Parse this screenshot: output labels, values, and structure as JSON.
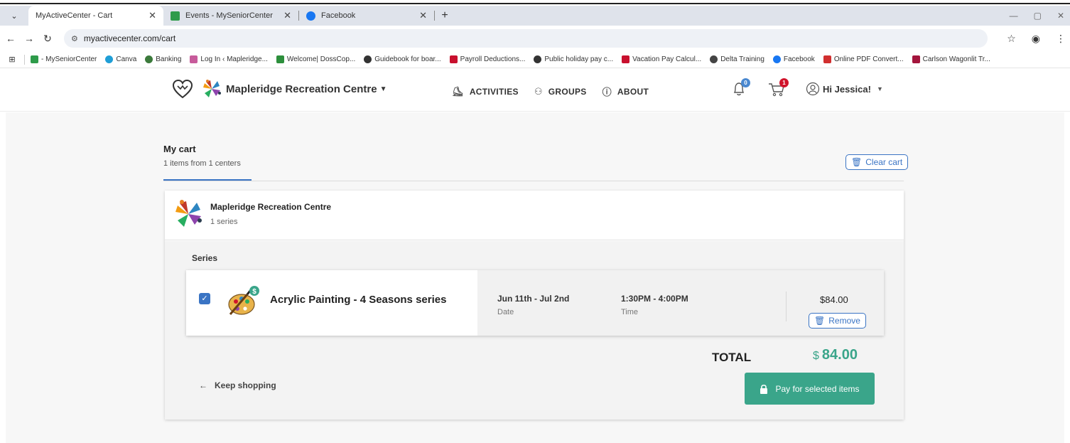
{
  "browser": {
    "tabs": [
      {
        "title": "MyActiveCenter - Cart",
        "active": true
      },
      {
        "title": "Events - MySeniorCenter",
        "active": false
      },
      {
        "title": "Facebook",
        "active": false
      }
    ],
    "url": "myactivecenter.com/cart",
    "bookmarks": [
      {
        "label": "- MySeniorCenter",
        "color": "#2e9b4a"
      },
      {
        "label": "Canva",
        "color": "#1f9ed6"
      },
      {
        "label": "Banking",
        "color": "#3b7a3b"
      },
      {
        "label": "Log In ‹ Mapleridge...",
        "color": "#c75b9b"
      },
      {
        "label": "Welcome| DossCop...",
        "color": "#2d8f3c"
      },
      {
        "label": "Guidebook for boar...",
        "color": "#333333"
      },
      {
        "label": "Payroll Deductions...",
        "color": "#c8102e"
      },
      {
        "label": "Public holiday pay c...",
        "color": "#333333"
      },
      {
        "label": "Vacation Pay Calcul...",
        "color": "#c8102e"
      },
      {
        "label": "Delta Training",
        "color": "#444444"
      },
      {
        "label": "Facebook",
        "color": "#1877f2"
      },
      {
        "label": "Online PDF Convert...",
        "color": "#d12f2f"
      },
      {
        "label": "Carlson Wagonlit Tr...",
        "color": "#a3153c"
      }
    ]
  },
  "header": {
    "center_name": "Mapleridge Recreation Centre",
    "nav": [
      {
        "label": "ACTIVITIES",
        "icon": "ice-skate-icon"
      },
      {
        "label": "GROUPS",
        "icon": "people-icon"
      },
      {
        "label": "ABOUT",
        "icon": "question-circle-icon"
      }
    ],
    "notifications_count": "0",
    "cart_count": "1",
    "greeting": "Hi Jessica!"
  },
  "cart": {
    "title": "My cart",
    "subtitle": "1 items from 1 centers",
    "clear_label": "Clear cart",
    "center": {
      "name": "Mapleridge Recreation Centre",
      "count": "1 series"
    },
    "section_label": "Series",
    "item": {
      "title": "Acrylic Painting - 4 Seasons series",
      "date_value": "Jun 11th - Jul 2nd",
      "date_label": "Date",
      "time_value": "1:30PM - 4:00PM",
      "time_label": "Time",
      "price": "$84.00",
      "remove_label": "Remove",
      "checked": true
    },
    "total_label": "TOTAL",
    "total_currency": "$",
    "total_amount": "84.00",
    "keep_shopping_label": "Keep shopping",
    "pay_label": "Pay for selected items"
  },
  "colors": {
    "accent_blue": "#3a74c4",
    "accent_green": "#3aa58a",
    "badge_red": "#d0142c"
  }
}
